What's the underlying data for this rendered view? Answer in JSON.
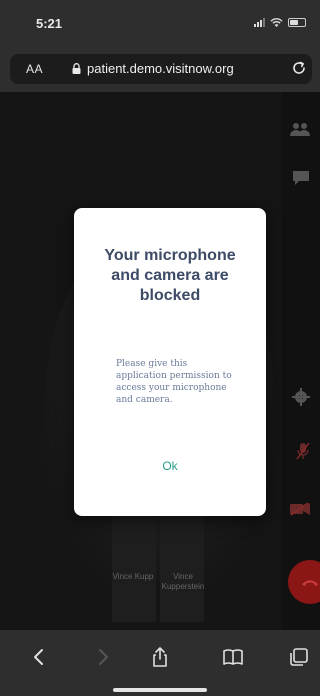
{
  "status_bar": {
    "time": "5:21",
    "icons": [
      "signal-icon",
      "wifi-icon",
      "battery-icon"
    ]
  },
  "browser": {
    "text_size_button": "AA",
    "url": "patient.demo.visitnow.org",
    "icons": [
      "lock-icon",
      "reload-icon"
    ]
  },
  "video_call": {
    "participants": [
      {
        "name": "Vince Kupp"
      },
      {
        "name": "Vince Kupperstein"
      }
    ],
    "side_controls": [
      "participants-icon",
      "chat-icon",
      "settings-icon",
      "microphone-icon",
      "camera-icon",
      "end-call-icon"
    ],
    "colors": {
      "end_call": "#8a1616"
    }
  },
  "dialog": {
    "title": "Your microphone and camera are blocked",
    "message": "Please give this application permission to access your microphone and camera.",
    "ok_label": "Ok",
    "colors": {
      "title": "#3d4b66",
      "message": "#6b7a99",
      "ok": "#2a9c8c"
    }
  },
  "toolbar": {
    "items": [
      "back-icon",
      "forward-icon",
      "share-icon",
      "bookmarks-icon",
      "tabs-icon"
    ]
  }
}
